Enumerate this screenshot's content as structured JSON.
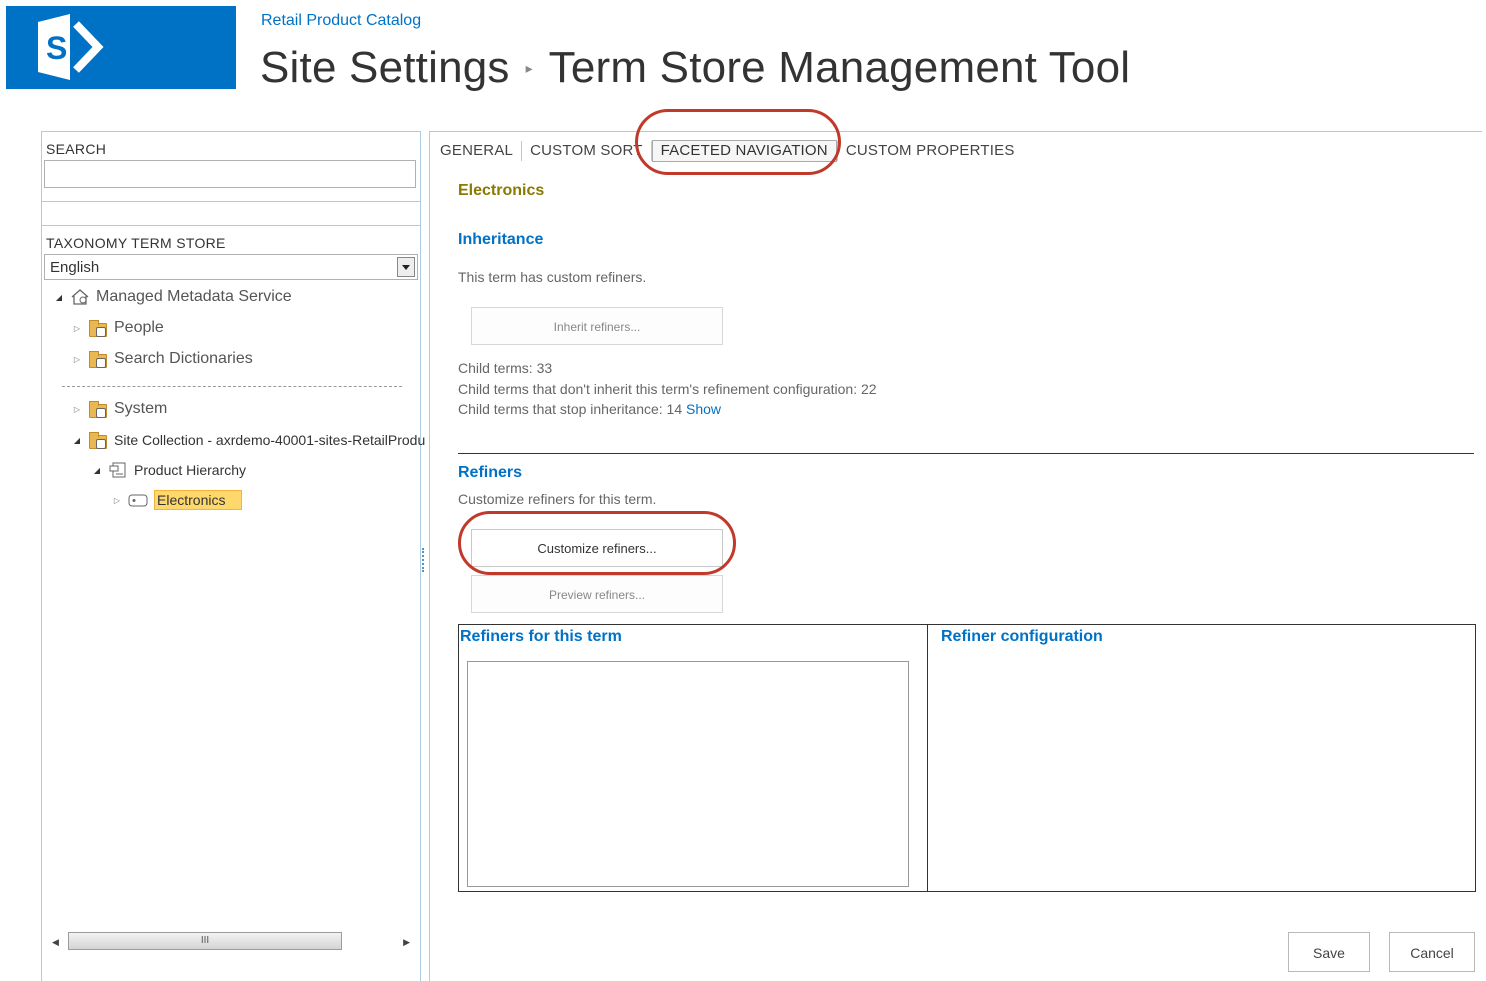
{
  "header": {
    "logo_alt": "SharePoint",
    "site_link": "Retail Product Catalog",
    "breadcrumb": [
      "Site Settings",
      "Term Store Management Tool"
    ],
    "breadcrumb_separator": "▸"
  },
  "left_panel": {
    "search_label": "SEARCH",
    "search_value": "",
    "taxonomy_label": "TAXONOMY TERM STORE",
    "language": "English",
    "tree": {
      "root": "Managed Metadata Service",
      "people": "People",
      "search_dictionaries": "Search Dictionaries",
      "system": "System",
      "site_collection": "Site Collection - axrdemo-40001-sites-RetailProdu",
      "term_set": "Product Hierarchy",
      "selected_term": "Electronics"
    },
    "scroll_thumb_label": "III"
  },
  "tabs": {
    "items": [
      "GENERAL",
      "CUSTOM SORT",
      "FACETED NAVIGATION",
      "CUSTOM PROPERTIES"
    ],
    "active": "FACETED NAVIGATION"
  },
  "content": {
    "term_name": "Electronics",
    "inheritance_heading": "Inheritance",
    "inheritance_desc": "This term has custom refiners.",
    "inherit_button": "Inherit refiners...",
    "child_terms": "Child terms: 33",
    "child_terms_not_inherit": "Child terms that don't inherit this term's refinement configuration: 22",
    "child_terms_stop": "Child terms that stop inheritance: 14",
    "show_link": "Show",
    "refiners_heading": "Refiners",
    "refiners_desc": "Customize refiners for this term.",
    "customize_button": "Customize refiners...",
    "preview_button": "Preview refiners...",
    "refiners_for_term_heading": "Refiners for this term",
    "refiner_config_heading": "Refiner configuration",
    "save_button": "Save",
    "cancel_button": "Cancel"
  },
  "colors": {
    "brand": "#0072c6",
    "term_name": "#8a7a00",
    "selection": "#ffd86b",
    "highlight_ring": "#c0392b"
  }
}
